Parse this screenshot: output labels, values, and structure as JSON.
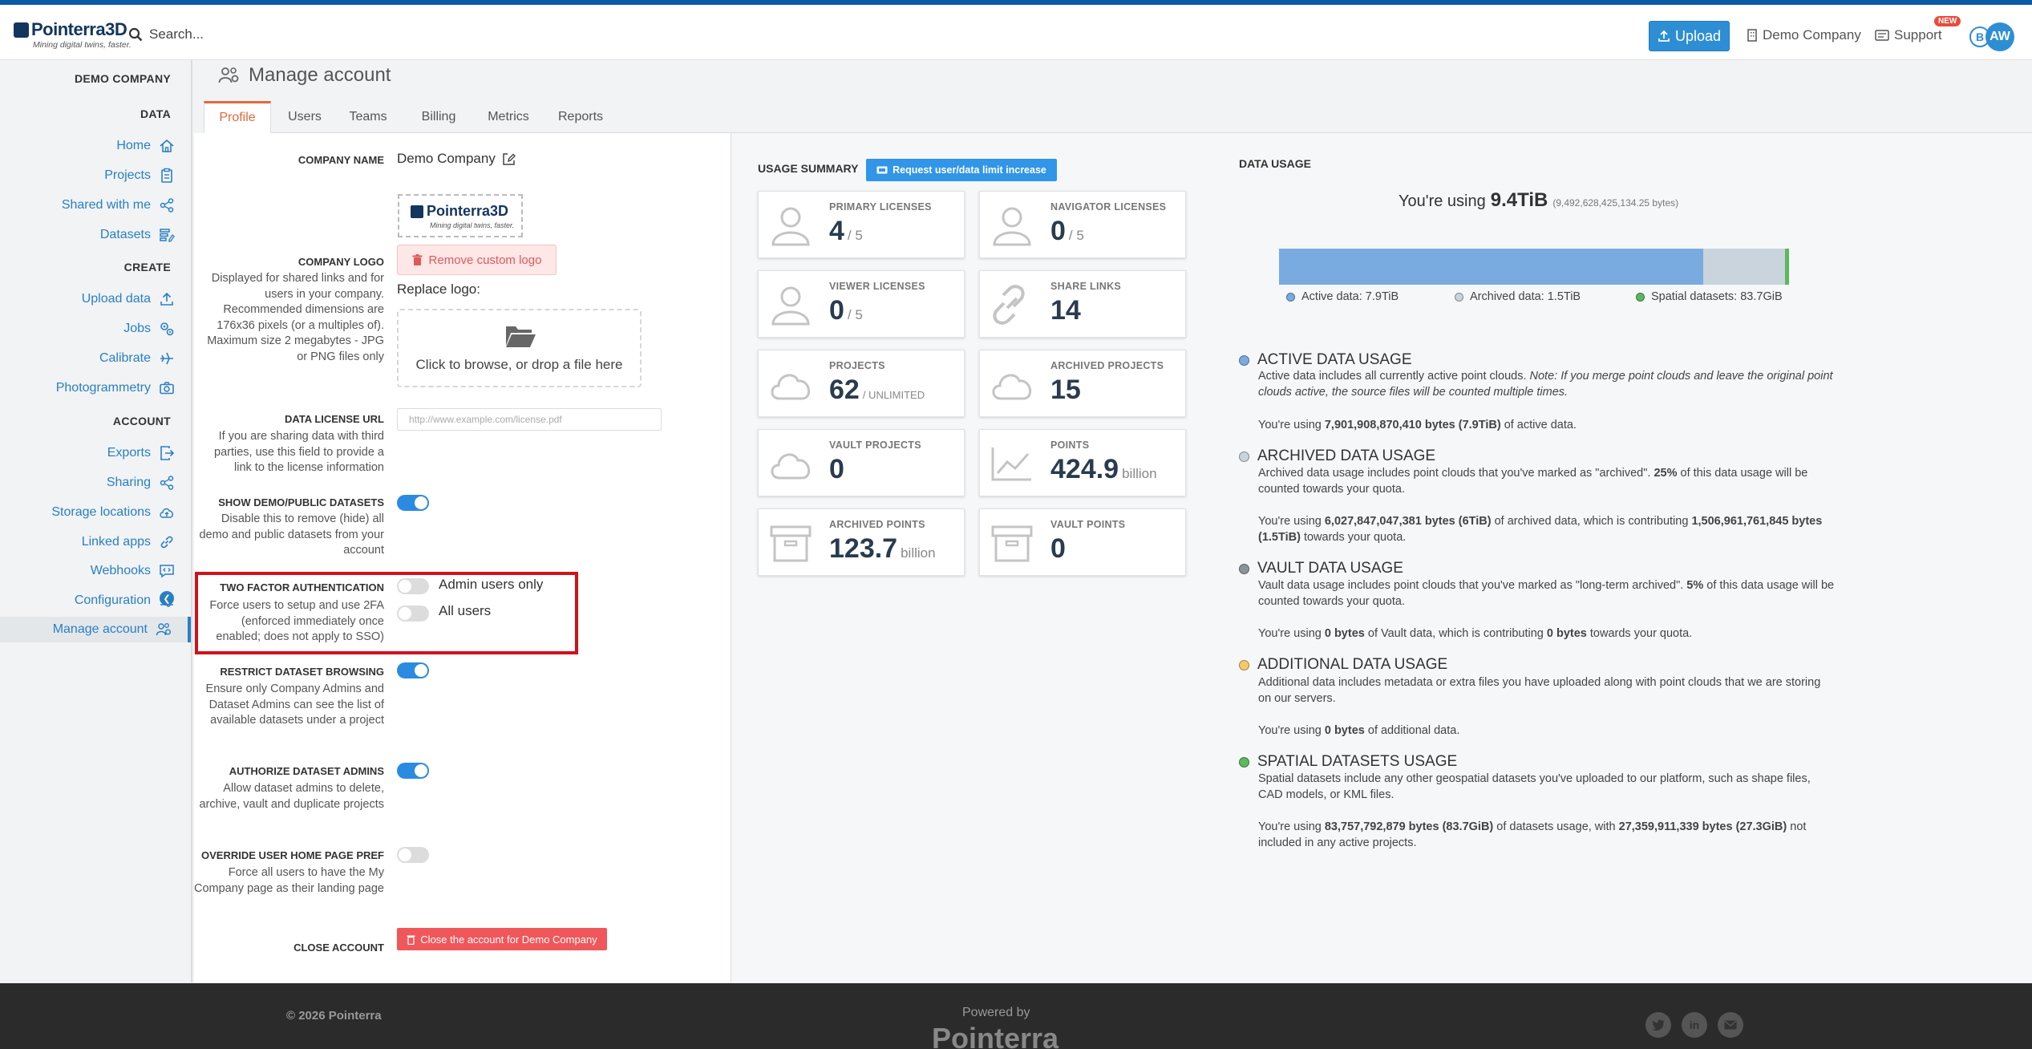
{
  "header": {
    "logo_text": "Pointerra3D",
    "logo_tagline": "Mining digital twins, faster.",
    "search_placeholder": "Search...",
    "upload_label": "Upload",
    "company_label": "Demo Company",
    "support_label": "Support",
    "new_badge": "NEW",
    "avatar_b": "B",
    "avatar_initials": "AW"
  },
  "sidebar": {
    "company": "DEMO COMPANY",
    "data_title": "DATA",
    "create_title": "CREATE",
    "account_title": "ACCOUNT",
    "data_items": [
      "Home",
      "Projects",
      "Shared with me",
      "Datasets"
    ],
    "create_items": [
      "Upload data",
      "Jobs",
      "Calibrate",
      "Photogrammetry"
    ],
    "account_items": [
      "Exports",
      "Sharing",
      "Storage locations",
      "Linked apps",
      "Webhooks",
      "Configuration",
      "Manage account"
    ]
  },
  "page": {
    "title": "Manage account",
    "tabs": [
      "Profile",
      "Users",
      "Teams",
      "Billing",
      "Metrics",
      "Reports"
    ],
    "active_tab": "Profile"
  },
  "profile": {
    "company_name_label": "COMPANY NAME",
    "company_name_value": "Demo Company",
    "company_logo_label": "COMPANY LOGO",
    "company_logo_help": "Displayed for shared links and for users in your company. Recommended dimensions are 176x36 pixels (or a multiples of). Maximum size 2 megabytes - JPG or PNG files only",
    "remove_logo_label": "Remove custom logo",
    "replace_logo_label": "Replace logo:",
    "dropzone_text": "Click to browse, or drop a file here",
    "data_license_label": "DATA LICENSE URL",
    "data_license_help": "If you are sharing data with third parties, use this field to provide a link to the license information",
    "data_license_placeholder": "http://www.example.com/license.pdf",
    "demo_label": "SHOW DEMO/PUBLIC DATASETS",
    "demo_help": "Disable this to remove (hide) all demo and public datasets from your account",
    "tfa_label": "TWO FACTOR AUTHENTICATION",
    "tfa_help": "Force users to setup and use 2FA (enforced immediately once enabled; does not apply to SSO)",
    "tfa_admin_label": "Admin users only",
    "tfa_all_label": "All users",
    "restrict_label": "RESTRICT DATASET BROWSING",
    "restrict_help": "Ensure only Company Admins and Dataset Admins can see the list of available datasets under a project",
    "authorize_label": "AUTHORIZE DATASET ADMINS",
    "authorize_help": "Allow dataset admins to delete, archive, vault and duplicate projects",
    "override_label": "OVERRIDE USER HOME PAGE PREF",
    "override_help": "Force all users to have the My Company page as their landing page",
    "close_label": "CLOSE ACCOUNT",
    "close_button": "Close the account for Demo Company"
  },
  "usage": {
    "title": "USAGE SUMMARY",
    "request_button": "Request user/data limit increase",
    "cards": [
      {
        "title": "PRIMARY LICENSES",
        "value": "4",
        "sub": "/ 5",
        "icon": "user-icon"
      },
      {
        "title": "NAVIGATOR LICENSES",
        "value": "0",
        "sub": "/ 5",
        "icon": "user-icon"
      },
      {
        "title": "VIEWER LICENSES",
        "value": "0",
        "sub": "/ 5",
        "icon": "user-icon"
      },
      {
        "title": "SHARE LINKS",
        "value": "14",
        "sub": "",
        "icon": "link-icon"
      },
      {
        "title": "PROJECTS",
        "value": "62",
        "sub": "/ UNLIMITED",
        "icon": "cloud-icon"
      },
      {
        "title": "ARCHIVED PROJECTS",
        "value": "15",
        "sub": "",
        "icon": "cloud-icon"
      },
      {
        "title": "VAULT PROJECTS",
        "value": "0",
        "sub": "",
        "icon": "cloud-icon"
      },
      {
        "title": "POINTS",
        "value": "424.9",
        "sub": "billion",
        "icon": "line-chart-icon"
      },
      {
        "title": "ARCHIVED POINTS",
        "value": "123.7",
        "sub": "billion",
        "icon": "archive-icon"
      },
      {
        "title": "VAULT POINTS",
        "value": "0",
        "sub": "",
        "icon": "archive-icon"
      }
    ]
  },
  "data_usage": {
    "title": "DATA USAGE",
    "using_prefix": "You're using",
    "using_value": "9.4TiB",
    "using_bytes": "(9,492,628,425,134.25 bytes)",
    "bar_fractions": {
      "active": 0.832,
      "archived": 0.16,
      "spatial": 0.008
    },
    "colors": {
      "active": "#7aabe0",
      "archived": "#c9d4dc",
      "spatial": "#5cb85c",
      "vault": "#8a9499",
      "additional": "#f5c96b"
    },
    "legend": [
      "Active data: 7.9TiB",
      "Archived data: 1.5TiB",
      "Spatial datasets: 83.7GiB"
    ],
    "sections": [
      {
        "title": "ACTIVE DATA USAGE",
        "desc": "Active data includes all currently active point clouds.",
        "note": "Note: If you merge point clouds and leave the original point clouds active, the source files will be counted multiple times.",
        "using_prefix": "You're using",
        "using_bold": "7,901,908,870,410 bytes (7.9TiB)",
        "using_suffix": "of active data."
      },
      {
        "title": "ARCHIVED DATA USAGE",
        "desc_a": "Archived data usage includes point clouds that you've marked as \"archived\".",
        "desc_pct": "25%",
        "desc_b": "of this data usage will be counted towards your quota.",
        "using_prefix": "You're using",
        "using_bold": "6,027,847,047,381 bytes (6TiB)",
        "using_mid": "of archived data, which is contributing",
        "using_bold2": "1,506,961,761,845 bytes (1.5TiB)",
        "using_suffix": "towards your quota."
      },
      {
        "title": "VAULT DATA USAGE",
        "desc_a": "Vault data usage includes point clouds that you've marked as \"long-term archived\".",
        "desc_pct": "5%",
        "desc_b": "of this data usage will be counted towards your quota.",
        "using_prefix": "You're using",
        "using_bold": "0 bytes",
        "using_mid": "of Vault data, which is contributing",
        "using_bold2": "0 bytes",
        "using_suffix": "towards your quota."
      },
      {
        "title": "ADDITIONAL DATA USAGE",
        "desc": "Additional data includes metadata or extra files you have uploaded along with point clouds that we are storing on our servers.",
        "using_prefix": "You're using",
        "using_bold": "0 bytes",
        "using_suffix": "of additional data."
      },
      {
        "title": "SPATIAL DATASETS USAGE",
        "desc": "Spatial datasets include any other geospatial datasets you've uploaded to our platform, such as shape files, CAD models, or KML files.",
        "using_prefix": "You're using",
        "using_bold": "83,757,792,879 bytes (83.7GiB)",
        "using_mid": "of datasets usage, with",
        "using_bold2": "27,359,911,339 bytes (27.3GiB)",
        "using_suffix": "not included in any active projects."
      }
    ]
  },
  "footer": {
    "copyright": "© 2026 Pointerra",
    "powered_by": "Powered by",
    "brand": "Pointerra",
    "social": [
      "twitter-icon",
      "linkedin-icon",
      "email-icon"
    ],
    "linkedin_text": "in"
  }
}
